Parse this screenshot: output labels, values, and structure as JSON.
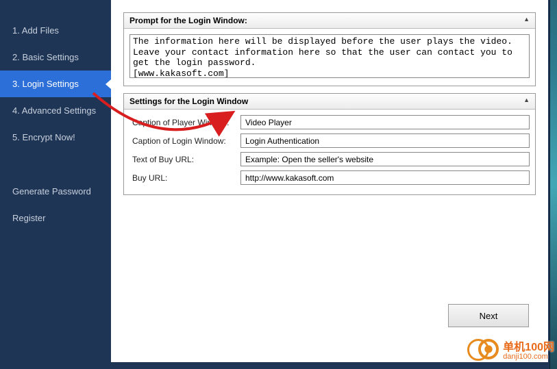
{
  "sidebar": {
    "items": [
      {
        "label": "1. Add Files"
      },
      {
        "label": "2. Basic Settings"
      },
      {
        "label": "3. Login Settings"
      },
      {
        "label": "4. Advanced Settings"
      },
      {
        "label": "5. Encrypt Now!"
      }
    ],
    "extra": [
      {
        "label": "Generate Password"
      },
      {
        "label": "Register"
      }
    ]
  },
  "panels": {
    "prompt": {
      "title": "Prompt for the Login Window:",
      "text": "The information here will be displayed before the user plays the video.\nLeave your contact information here so that the user can contact you to get the login password.\n[www.kakasoft.com]"
    },
    "settings": {
      "title": "Settings for the Login Window",
      "rows": {
        "caption_player": {
          "label": "Caption of Player Window:",
          "value": "Video Player"
        },
        "caption_login": {
          "label": "Caption of Login Window:",
          "value": "Login Authentication"
        },
        "buy_text": {
          "label": "Text of Buy URL:",
          "value": "Example: Open the seller's website"
        },
        "buy_url": {
          "label": "Buy URL:",
          "value": "http://www.kakasoft.com"
        }
      }
    }
  },
  "buttons": {
    "next": "Next"
  },
  "watermark": {
    "title": "单机100网",
    "sub": "danji100.com"
  }
}
